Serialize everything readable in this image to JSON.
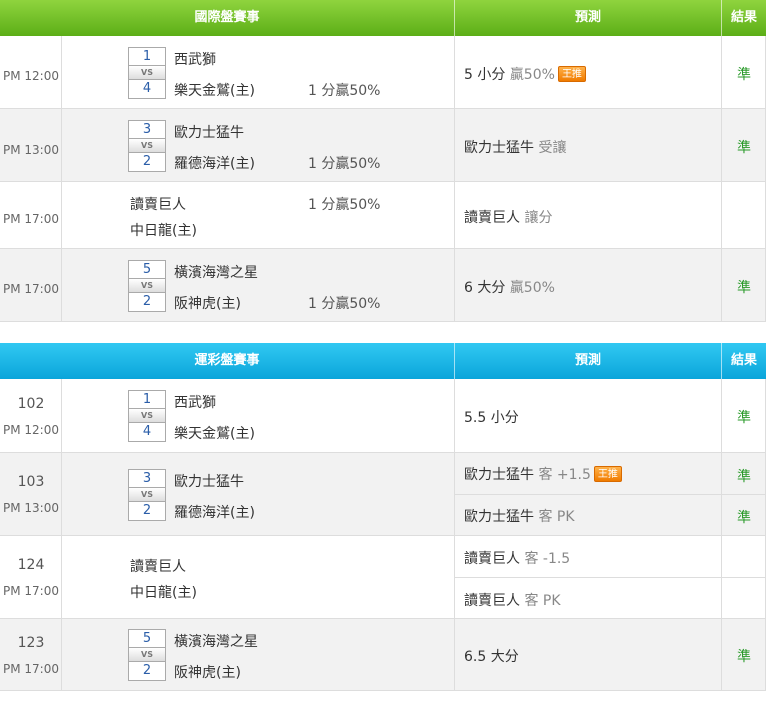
{
  "intl": {
    "header": {
      "game": "國際盤賽事",
      "prediction": "預測",
      "result": "結果"
    },
    "rows": [
      {
        "time": "PM 12:00",
        "score_away": "1",
        "vs": "VS",
        "score_home": "4",
        "away": "西武獅",
        "home": "樂天金鷲(主)",
        "odds": "1 分贏50%",
        "pred_main": "5 小分",
        "pred_gray": "贏50%",
        "badge": "王推",
        "result": "準"
      },
      {
        "time": "PM 13:00",
        "score_away": "3",
        "vs": "VS",
        "score_home": "2",
        "away": "歐力士猛牛",
        "home": "羅德海洋(主)",
        "odds": "1 分贏50%",
        "pred_main": "歐力士猛牛",
        "pred_gray": "受讓",
        "result": "準"
      },
      {
        "time": "PM 17:00",
        "away": "讀賣巨人",
        "home": "中日龍(主)",
        "odds": "1 分贏50%",
        "pred_main": "讀賣巨人",
        "pred_gray": "讓分"
      },
      {
        "time": "PM 17:00",
        "score_away": "5",
        "vs": "VS",
        "score_home": "2",
        "away": "橫濱海灣之星",
        "home": "阪神虎(主)",
        "odds": "1 分贏50%",
        "pred_main": "6 大分",
        "pred_gray": "贏50%",
        "result": "準"
      }
    ]
  },
  "lottery": {
    "header": {
      "game": "運彩盤賽事",
      "prediction": "預測",
      "result": "結果"
    },
    "rows": [
      {
        "num": "102",
        "time": "PM 12:00",
        "score_away": "1",
        "vs": "VS",
        "score_home": "4",
        "away": "西武獅",
        "home": "樂天金鷲(主)",
        "pred1_main": "5.5 小分",
        "result1": "準"
      },
      {
        "num": "103",
        "time": "PM 13:00",
        "score_away": "3",
        "vs": "VS",
        "score_home": "2",
        "away": "歐力士猛牛",
        "home": "羅德海洋(主)",
        "pred1_main": "歐力士猛牛",
        "pred1_gray": "客 +1.5",
        "badge": "王推",
        "result1": "準",
        "pred2_main": "歐力士猛牛",
        "pred2_gray": "客 PK",
        "result2": "準"
      },
      {
        "num": "124",
        "time": "PM 17:00",
        "away": "讀賣巨人",
        "home": "中日龍(主)",
        "pred1_main": "讀賣巨人",
        "pred1_gray": "客 -1.5",
        "pred2_main": "讀賣巨人",
        "pred2_gray": "客 PK"
      },
      {
        "num": "123",
        "time": "PM 17:00",
        "score_away": "5",
        "vs": "VS",
        "score_home": "2",
        "away": "橫濱海灣之星",
        "home": "阪神虎(主)",
        "pred1_main": "6.5 大分",
        "result1": "準"
      }
    ]
  },
  "colors": {
    "intl_header": "#6cbf22",
    "lottery_header": "#17b4e6",
    "result_green": "#2a9a2a",
    "badge_orange": "#f58a0c"
  }
}
